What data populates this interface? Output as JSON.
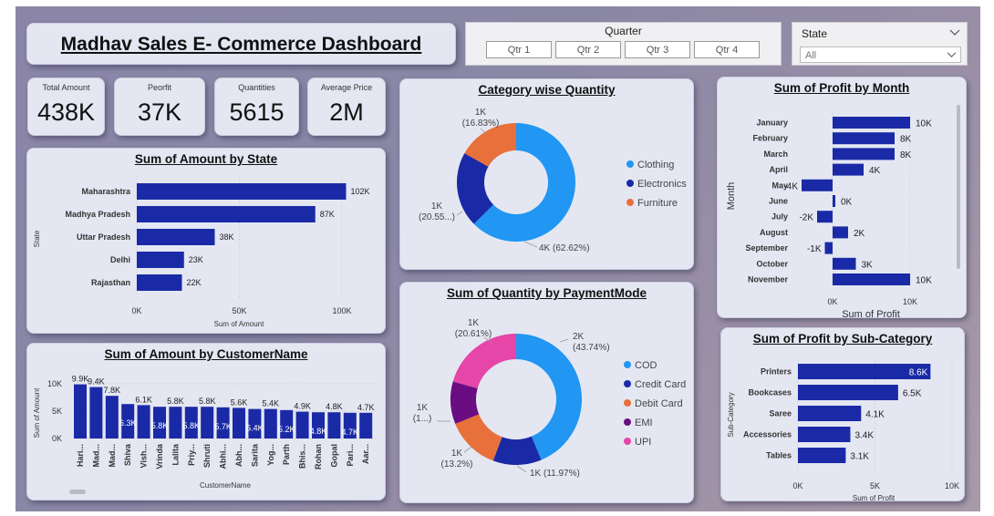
{
  "title": "Madhav Sales E- Commerce Dashboard",
  "quarter_slicer": {
    "label": "Quarter",
    "options": [
      "Qtr 1",
      "Qtr 2",
      "Qtr 3",
      "Qtr 4"
    ]
  },
  "state_slicer": {
    "label": "State",
    "value": "All"
  },
  "kpis": [
    {
      "label": "Total Amount",
      "value": "438K"
    },
    {
      "label": "Peorfit",
      "value": "37K"
    },
    {
      "label": "Quantities",
      "value": "5615"
    },
    {
      "label": "Average Price",
      "value": "2M"
    }
  ],
  "colors": {
    "bar": "#1a2aa6",
    "accent_light": "#2196f3",
    "orange": "#e8703a",
    "purple": "#6a0d83",
    "pink": "#e546a8"
  },
  "chart_data": [
    {
      "type": "bar",
      "orientation": "horizontal",
      "title": "Sum of Amount by State",
      "xlabel": "Sum of Amount",
      "ylabel": "State",
      "categories": [
        "Maharashtra",
        "Madhya Pradesh",
        "Uttar Pradesh",
        "Delhi",
        "Rajasthan"
      ],
      "values": [
        102,
        87,
        38,
        23,
        22
      ],
      "data_labels": [
        "102K",
        "87K",
        "38K",
        "23K",
        "22K"
      ],
      "xticks": [
        "0K",
        "50K",
        "100K"
      ],
      "xlim": [
        0,
        100
      ]
    },
    {
      "type": "bar",
      "title": "Sum of Amount by CustomerName",
      "xlabel": "CustomerName",
      "ylabel": "Sum of Amount",
      "categories": [
        "Hari...",
        "Mad...",
        "Mad...",
        "Shiva",
        "Vish...",
        "Vrinda",
        "Lalita",
        "Priy...",
        "Shruti",
        "Abhi...",
        "Abh...",
        "Sarita",
        "Yog...",
        "Parth",
        "Bhis...",
        "Rohan",
        "Gopal",
        "Pari...",
        "Aar..."
      ],
      "values": [
        9.9,
        9.4,
        7.8,
        6.3,
        6.1,
        5.8,
        5.8,
        5.8,
        5.8,
        5.7,
        5.6,
        5.4,
        5.4,
        5.2,
        4.9,
        4.8,
        4.8,
        4.7,
        4.7
      ],
      "data_labels": [
        "9.9K",
        "9.4K",
        "7.8K",
        "6.3K",
        "6.1K",
        "5.8K",
        "5.8K",
        "5.8K",
        "5.8K",
        "5.7K",
        "5.6K",
        "5.4K",
        "5.4K",
        "5.2K",
        "4.9K",
        "4.8K",
        "4.8K",
        "4.7K",
        "4.7K"
      ],
      "yticks": [
        "0K",
        "5K",
        "10K"
      ],
      "ylim": [
        0,
        10
      ]
    },
    {
      "type": "pie",
      "variant": "donut",
      "title": "Category wise Quantity",
      "categories": [
        "Clothing",
        "Electronics",
        "Furniture"
      ],
      "values": [
        62.62,
        20.55,
        16.83
      ],
      "data_labels": [
        "4K (62.62%)",
        "1K\n(20.55...)",
        "1K\n(16.83%)"
      ],
      "colors": [
        "#2196f3",
        "#1a2aa6",
        "#e8703a"
      ],
      "legend": "right"
    },
    {
      "type": "pie",
      "variant": "donut",
      "title": "Sum of Quantity by PaymentMode",
      "categories": [
        "COD",
        "Credit Card",
        "Debit Card",
        "EMI",
        "UPI"
      ],
      "values": [
        43.74,
        11.97,
        13.2,
        10.48,
        20.61
      ],
      "data_labels": [
        "2K\n(43.74%)",
        "1K (11.97%)",
        "1K\n(13.2%)",
        "1K\n(1...)",
        "1K\n(20.61%)"
      ],
      "colors": [
        "#2196f3",
        "#1a2aa6",
        "#e8703a",
        "#6a0d83",
        "#e546a8"
      ],
      "legend": "right"
    },
    {
      "type": "bar",
      "orientation": "horizontal",
      "title": "Sum of Profit by Month",
      "xlabel": "Sum of Profit",
      "ylabel": "Month",
      "categories": [
        "January",
        "February",
        "March",
        "April",
        "May",
        "June",
        "July",
        "August",
        "September",
        "October",
        "November"
      ],
      "values": [
        10,
        8,
        8,
        4,
        -4,
        0,
        -2,
        2,
        -1,
        3,
        10
      ],
      "data_labels": [
        "10K",
        "8K",
        "8K",
        "4K",
        "-4K",
        "0K",
        "-2K",
        "2K",
        "-1K",
        "3K",
        "10K"
      ],
      "xticks": [
        "0K",
        "10K"
      ]
    },
    {
      "type": "bar",
      "orientation": "horizontal",
      "title": "Sum of Profit by Sub-Category",
      "xlabel": "Sum of Profit",
      "ylabel": "Sub-Category",
      "categories": [
        "Printers",
        "Bookcases",
        "Saree",
        "Accessories",
        "Tables"
      ],
      "values": [
        8.6,
        6.5,
        4.1,
        3.4,
        3.1
      ],
      "data_labels": [
        "8.6K",
        "6.5K",
        "4.1K",
        "3.4K",
        "3.1K"
      ],
      "xticks": [
        "0K",
        "5K",
        "10K"
      ],
      "xlim": [
        0,
        10
      ]
    }
  ]
}
